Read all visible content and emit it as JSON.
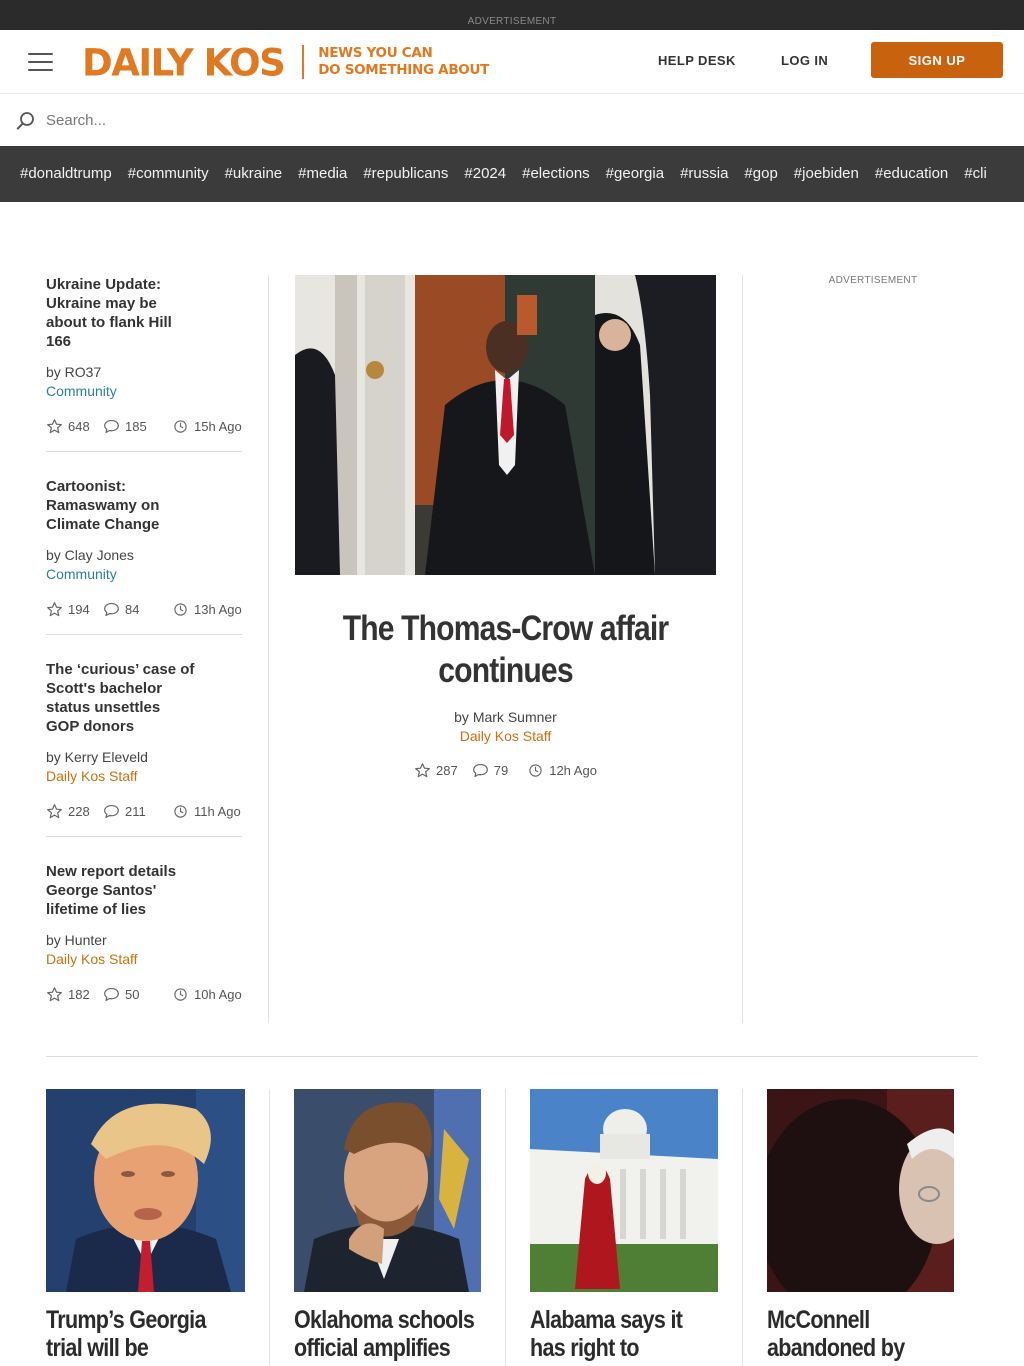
{
  "ad_top": {
    "label": "ADVERTISEMENT"
  },
  "header": {
    "logo_text": "DAILY KOS",
    "tagline_line1": "NEWS YOU CAN",
    "tagline_line2": "DO SOMETHING ABOUT",
    "help_desk": "HELP DESK",
    "log_in": "LOG IN",
    "sign_up": "SIGN UP",
    "brand_color": "#e0791f",
    "button_color": "#c8620f"
  },
  "search": {
    "placeholder": "Search..."
  },
  "tags": [
    "#donaldtrump",
    "#community",
    "#ukraine",
    "#media",
    "#republicans",
    "#2024",
    "#elections",
    "#georgia",
    "#russia",
    "#gop",
    "#joebiden",
    "#education",
    "#cli"
  ],
  "left_stories": [
    {
      "title": "Ukraine Update: Ukraine may be about to flank Hill 166",
      "byline": "by RO37",
      "category": "Community",
      "category_type": "community",
      "recs": "648",
      "comments": "185",
      "time": "15h Ago"
    },
    {
      "title": "Cartoonist: Ramaswamy on Climate Change",
      "byline": "by Clay Jones",
      "category": "Community",
      "category_type": "community",
      "recs": "194",
      "comments": "84",
      "time": "13h Ago"
    },
    {
      "title": "The ‘curious’ case of Scott's bachelor status unsettles GOP donors",
      "byline": "by Kerry Eleveld",
      "category": "Daily Kos Staff",
      "category_type": "staff",
      "recs": "228",
      "comments": "211",
      "time": "11h Ago"
    },
    {
      "title": "New report details George Santos' lifetime of lies",
      "byline": "by Hunter",
      "category": "Daily Kos Staff",
      "category_type": "staff",
      "recs": "182",
      "comments": "50",
      "time": "10h Ago"
    }
  ],
  "feature": {
    "title": "The Thomas-Crow affair continues",
    "byline": "by Mark Sumner",
    "category": "Daily Kos Staff",
    "recs": "287",
    "comments": "79",
    "time": "12h Ago"
  },
  "side_ad": {
    "label": "ADVERTISEMENT"
  },
  "cards": [
    {
      "title": "Trump’s Georgia trial will be televised,"
    },
    {
      "title": "Oklahoma schools official amplifies"
    },
    {
      "title": "Alabama says it has right to prosecute"
    },
    {
      "title": "McConnell abandoned by"
    }
  ]
}
